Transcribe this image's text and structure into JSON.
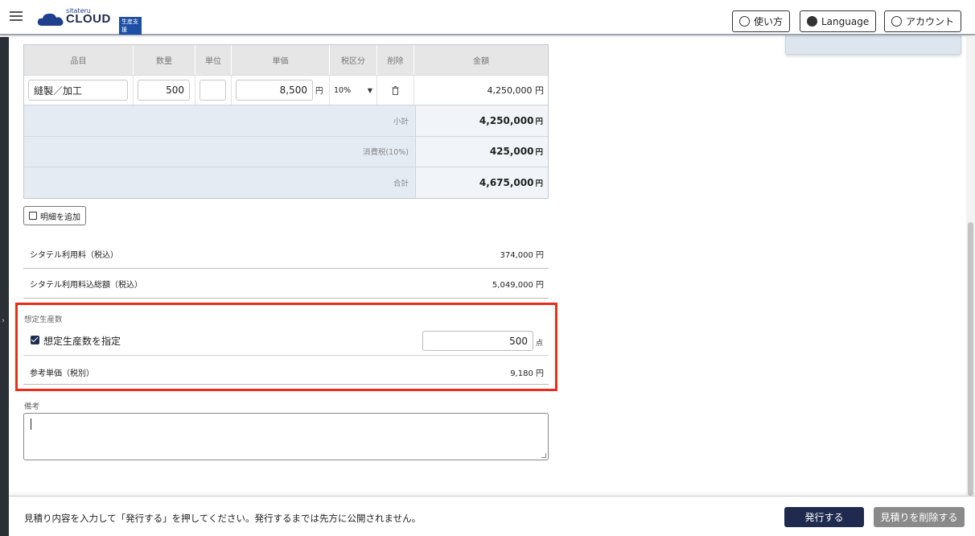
{
  "header": {
    "logo_small": "sitateru",
    "logo_brand": "CLOUD",
    "logo_badge": "生産支援",
    "help_label": "使い方",
    "language_label": "Language",
    "account_label": "アカウント"
  },
  "table": {
    "headers": [
      "品目",
      "数量",
      "単位",
      "単価",
      "税区分",
      "削除",
      "金額"
    ],
    "row": {
      "item": "縫製／加工",
      "quantity": "500",
      "unit": "",
      "unit_price": "8,500",
      "unit_price_currency": "円",
      "tax_class": "10%",
      "amount": "4,250,000 円"
    },
    "subtotal_label": "小計",
    "subtotal_value": "4,250,000",
    "tax_label": "消費税(10%)",
    "tax_value": "425,000",
    "total_label": "合計",
    "total_value": "4,675,000",
    "currency": "円"
  },
  "add_line_label": "明細を追加",
  "fees": [
    {
      "label": "シタテル利用料（税込）",
      "value": "374,000 円"
    },
    {
      "label": "シタテル利用料込総額（税込）",
      "value": "5,049,000 円"
    }
  ],
  "production": {
    "section_label": "想定生産数",
    "checkbox_label": "想定生産数を指定",
    "checkbox_checked": true,
    "quantity": "500",
    "quantity_unit": "点",
    "ref_price_label": "参考単価（税別）",
    "ref_price_value": "9,180 円"
  },
  "notes": {
    "label": "備考",
    "value": ""
  },
  "footer": {
    "message": "見積り内容を入力して「発行する」を押してください。発行するまでは先方に公開されません。",
    "issue_label": "発行する",
    "delete_label": "見積りを削除する"
  },
  "colors": {
    "highlight": "#ee2a1a",
    "primary": "#1f2a4e"
  }
}
